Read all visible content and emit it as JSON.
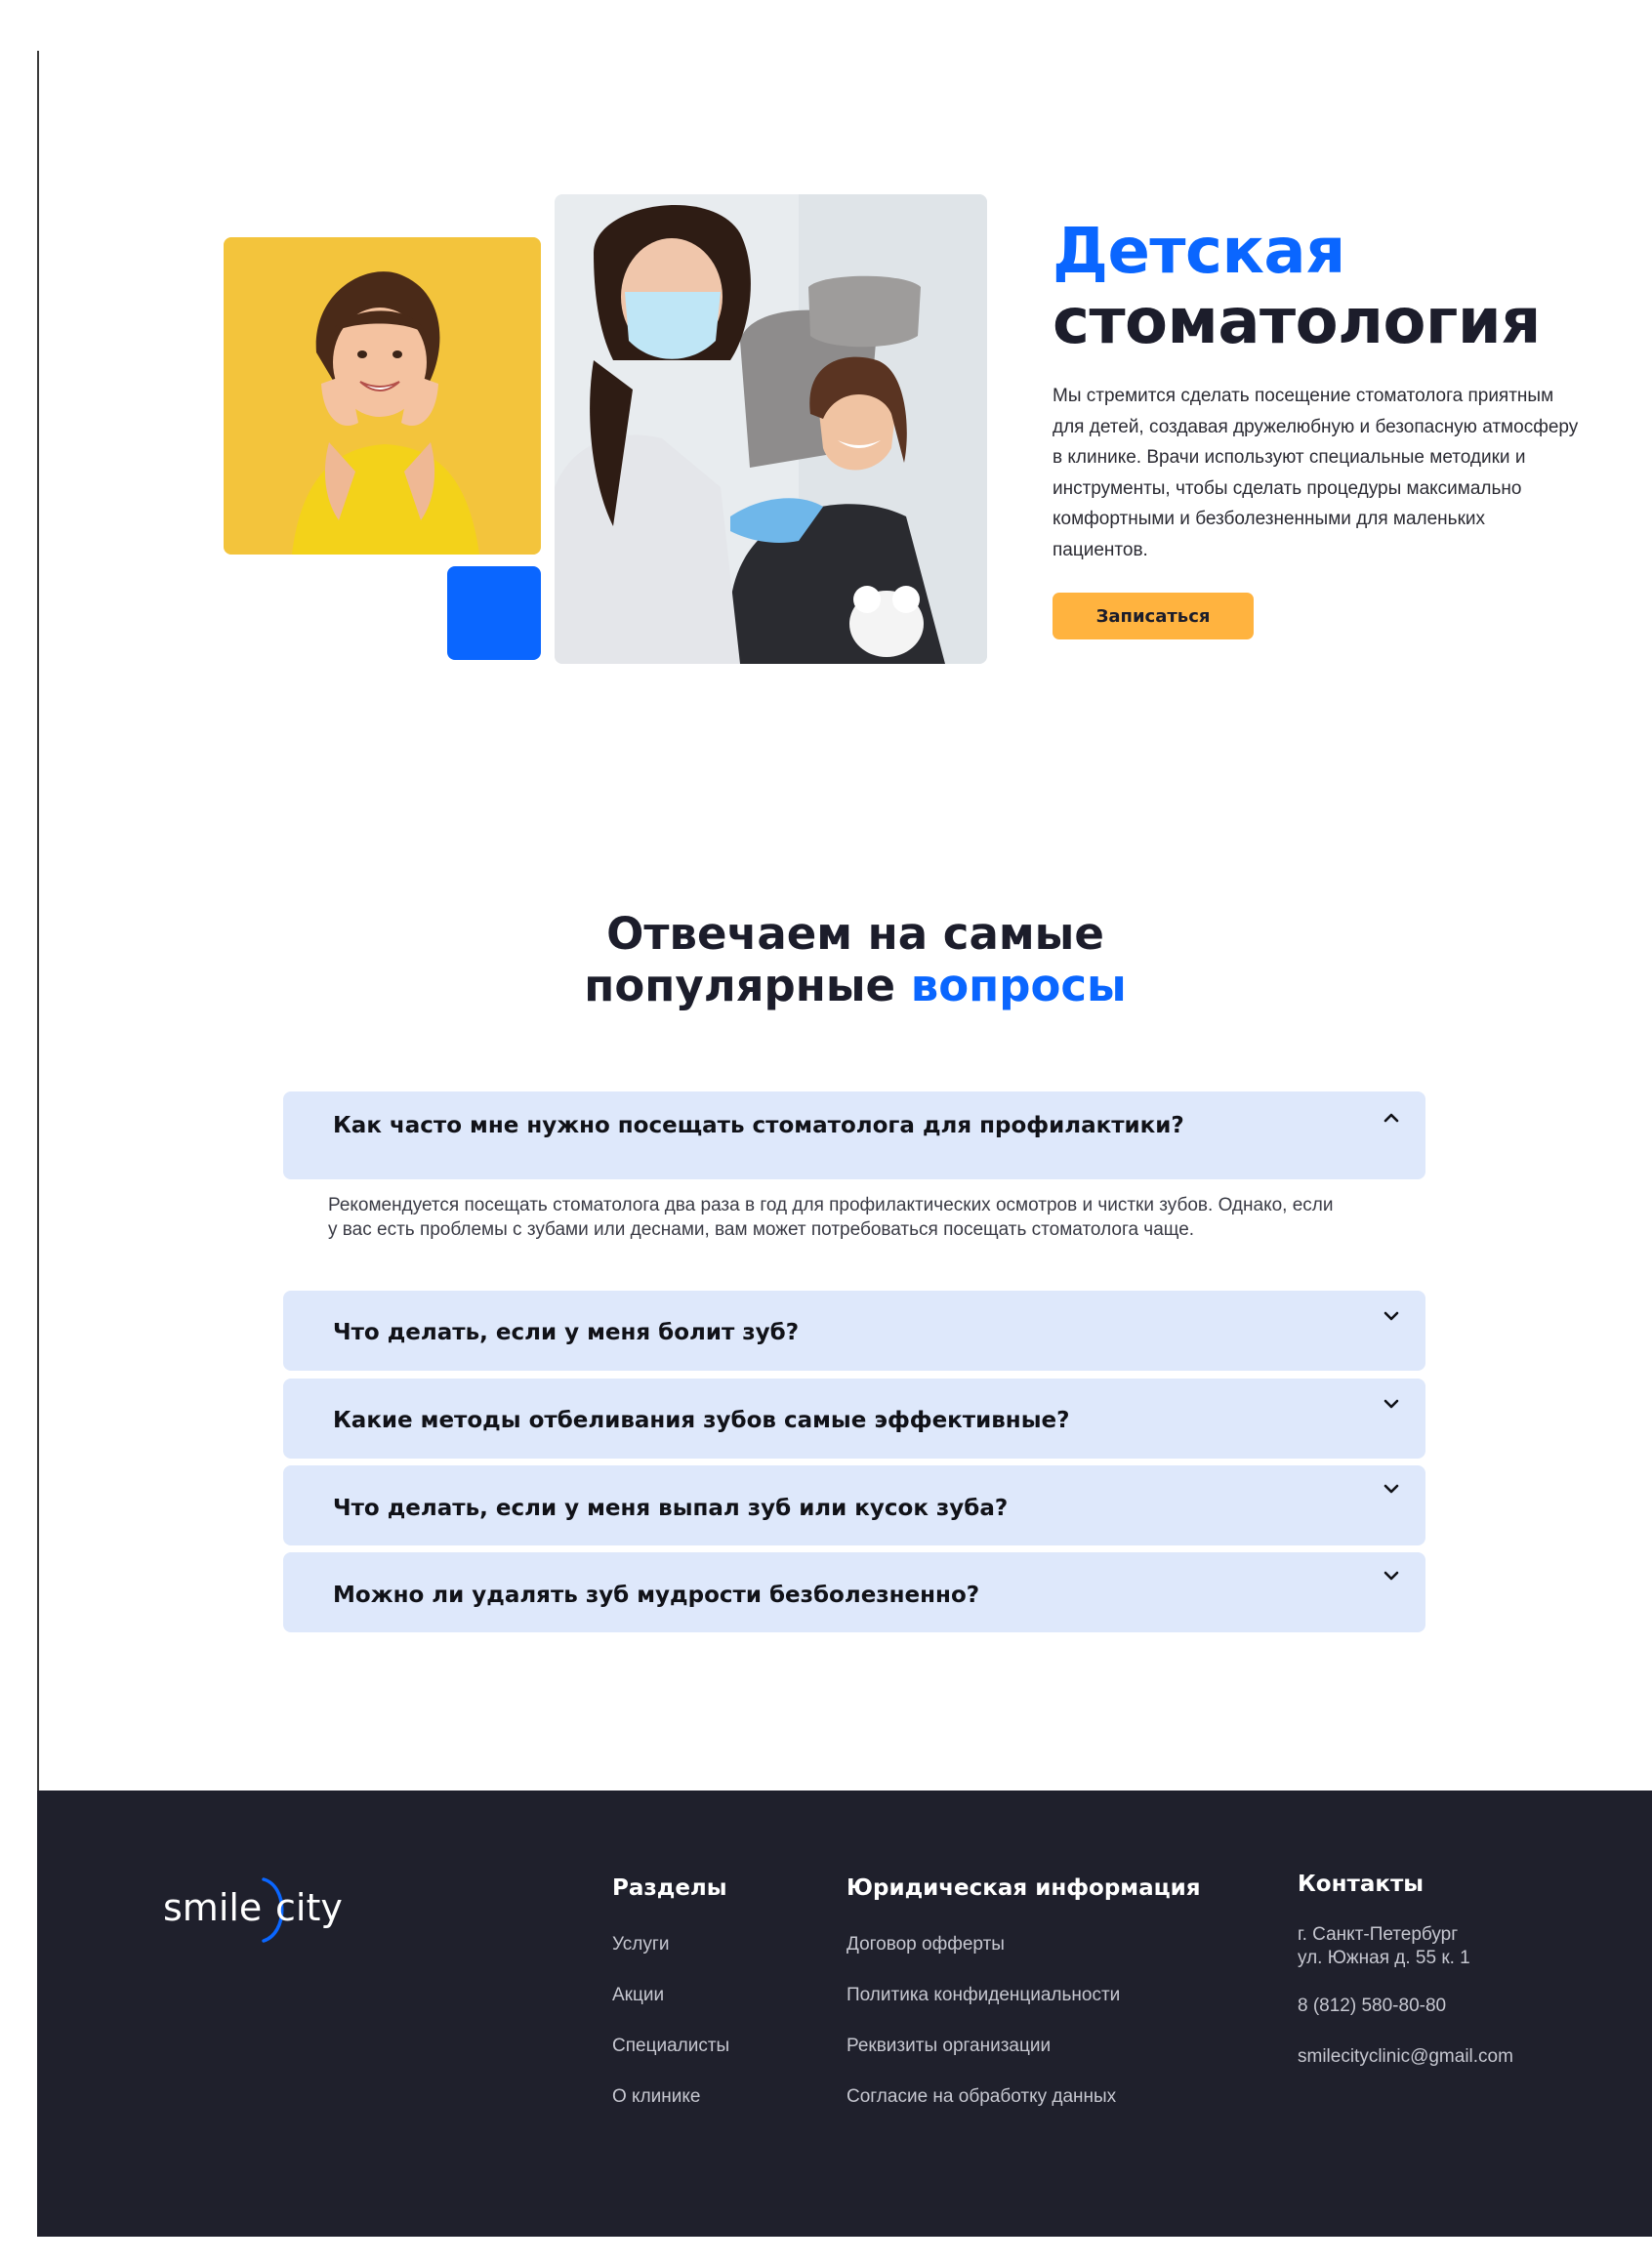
{
  "hero": {
    "title_accent": "Детская",
    "title_rest": "стоматология",
    "description": "Мы стремится сделать посещение стоматолога приятным для детей, создавая дружелюбную и безопасную атмосферу в клинике. Врачи используют специальные методики и инструменты, чтобы сделать процедуры максимально комфортными и безболезненными для маленьких пациентов.",
    "cta_label": "Записаться",
    "accent_color": "#0a66ff",
    "cta_color": "#ffb33f"
  },
  "faq": {
    "title_line1": "Отвечаем на самые",
    "title_line2_dark": "популярные",
    "title_line2_accent": "вопросы",
    "items": [
      {
        "question": "Как часто мне нужно посещать стоматолога для профилактики?",
        "expanded": true,
        "answer": "Рекомендуется посещать стоматолога два раза в год для профилактических осмотров и чистки зубов. Однако, если у вас есть проблемы с зубами или деснами, вам может потребоваться посещать стоматолога чаще."
      },
      {
        "question": "Что делать, если у меня болит зуб?",
        "expanded": false
      },
      {
        "question": "Какие методы отбеливания зубов самые эффективные?",
        "expanded": false
      },
      {
        "question": "Что делать, если у меня выпал зуб или кусок зуба?",
        "expanded": false
      },
      {
        "question": "Можно ли удалять зуб мудрости безболезненно?",
        "expanded": false
      }
    ]
  },
  "footer": {
    "logo_left": "smile",
    "logo_right": "city",
    "sections": {
      "title": "Разделы",
      "links": [
        "Услуги",
        "Акции",
        "Специалисты",
        "О клинике"
      ]
    },
    "legal": {
      "title": "Юридическая информация",
      "links": [
        "Договор офферты",
        "Политика конфиденциальности",
        "Реквизиты организации",
        "Согласие на обработку данных"
      ]
    },
    "contacts": {
      "title": "Контакты",
      "address_line1": "г. Санкт-Петербург",
      "address_line2": "ул. Южная д. 55 к. 1",
      "phone": "8 (812) 580-80-80",
      "email": "smilecityclinic@gmail.com"
    },
    "background_color": "#1f202c"
  }
}
